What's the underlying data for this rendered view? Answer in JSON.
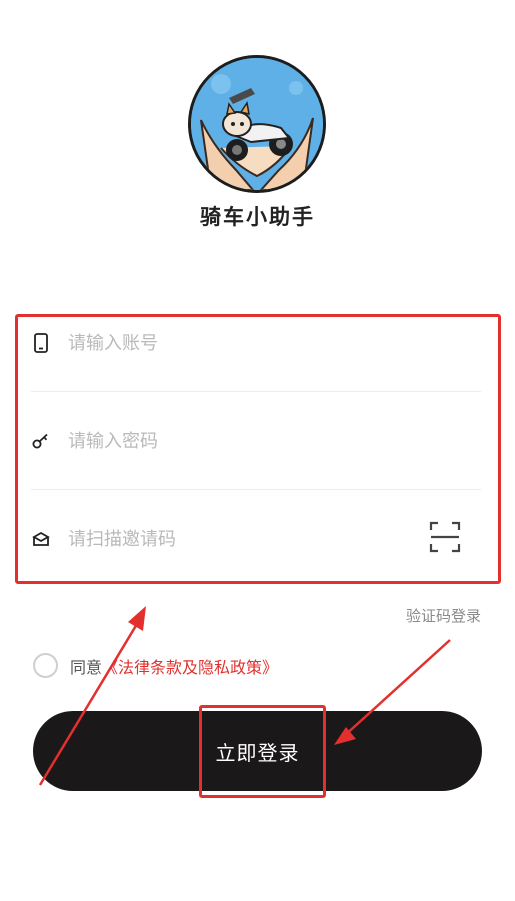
{
  "app": {
    "name": "骑车小助手"
  },
  "form": {
    "account_placeholder": "请输入账号",
    "password_placeholder": "请输入密码",
    "invite_placeholder": "请扫描邀请码"
  },
  "links": {
    "sms_login": "验证码登录"
  },
  "agreement": {
    "prefix": "同意",
    "policy": "《法律条款及隐私政策》"
  },
  "buttons": {
    "login": "立即登录"
  },
  "colors": {
    "accent_red": "#e3302f",
    "button_bg": "#1b1819",
    "placeholder": "#b9b9b9"
  },
  "icons": [
    "phone-icon",
    "key-icon",
    "envelope-icon",
    "scan-icon"
  ]
}
